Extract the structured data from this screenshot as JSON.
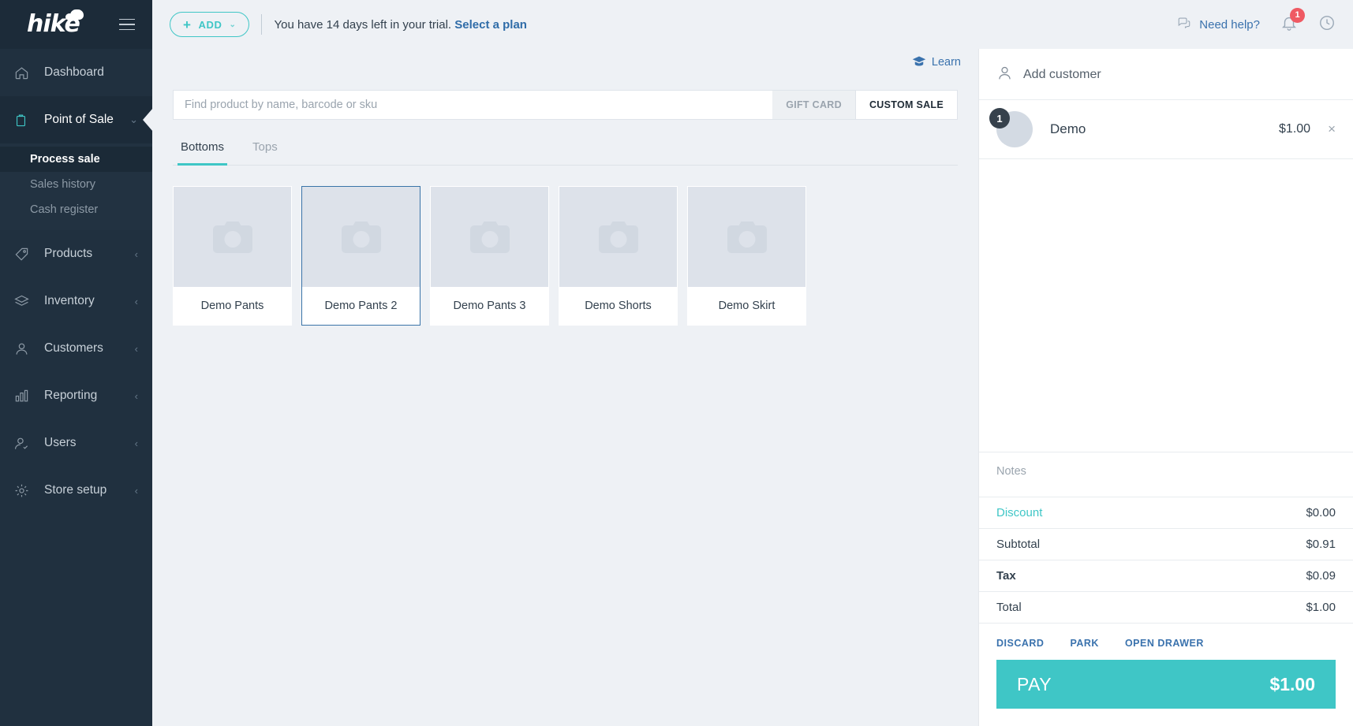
{
  "brand": {
    "logo_text": "hike",
    "accent": "#3fc6c6",
    "sidebar_bg": "#20303f",
    "link_blue": "#3a72ad",
    "select_border": "#3a74a8"
  },
  "sidebar": {
    "items": [
      {
        "label": "Dashboard",
        "icon": "home-icon",
        "chevron": ""
      },
      {
        "label": "Point of Sale",
        "icon": "bag-icon",
        "chevron": "⌄"
      },
      {
        "label": "Products",
        "icon": "tag-icon",
        "chevron": "‹"
      },
      {
        "label": "Inventory",
        "icon": "layers-icon",
        "chevron": "‹"
      },
      {
        "label": "Customers",
        "icon": "user-icon",
        "chevron": "‹"
      },
      {
        "label": "Reporting",
        "icon": "bar-chart-icon",
        "chevron": "‹"
      },
      {
        "label": "Users",
        "icon": "user-check-icon",
        "chevron": "‹"
      },
      {
        "label": "Store setup",
        "icon": "gear-icon",
        "chevron": "‹"
      }
    ],
    "subitems": [
      {
        "label": "Process sale",
        "active": true
      },
      {
        "label": "Sales history",
        "active": false
      },
      {
        "label": "Cash register",
        "active": false
      }
    ]
  },
  "topbar": {
    "add_label": "ADD",
    "add_plus": "+",
    "add_chevron": "⌄",
    "trial_text": "You have 14 days left in your trial.",
    "trial_link": "Select a plan",
    "need_help": "Need help?",
    "notification_count": "1"
  },
  "learn": {
    "label": "Learn"
  },
  "search": {
    "placeholder": "Find product by name, barcode or sku",
    "value": "",
    "gift_card": "GIFT CARD",
    "custom_sale": "CUSTOM SALE"
  },
  "tabs": [
    {
      "label": "Bottoms",
      "active": true
    },
    {
      "label": "Tops",
      "active": false
    }
  ],
  "products": [
    {
      "name": "Demo Pants",
      "selected": false
    },
    {
      "name": "Demo Pants 2",
      "selected": true
    },
    {
      "name": "Demo Pants 3",
      "selected": false
    },
    {
      "name": "Demo Shorts",
      "selected": false
    },
    {
      "name": "Demo Skirt",
      "selected": false
    }
  ],
  "cart": {
    "add_customer": "Add customer",
    "items": [
      {
        "qty": "1",
        "name": "Demo",
        "price": "$1.00",
        "remove": "×"
      }
    ],
    "notes_placeholder": "Notes",
    "totals": [
      {
        "key": "Discount",
        "value": "$0.00",
        "style": "accent"
      },
      {
        "key": "Subtotal",
        "value": "$0.91",
        "style": "normal"
      },
      {
        "key": "Tax",
        "value": "$0.09",
        "style": "bold"
      },
      {
        "key": "Total",
        "value": "$1.00",
        "style": "normal"
      }
    ],
    "actions": [
      "DISCARD",
      "PARK",
      "OPEN DRAWER"
    ],
    "pay_label": "PAY",
    "pay_amount": "$1.00"
  }
}
